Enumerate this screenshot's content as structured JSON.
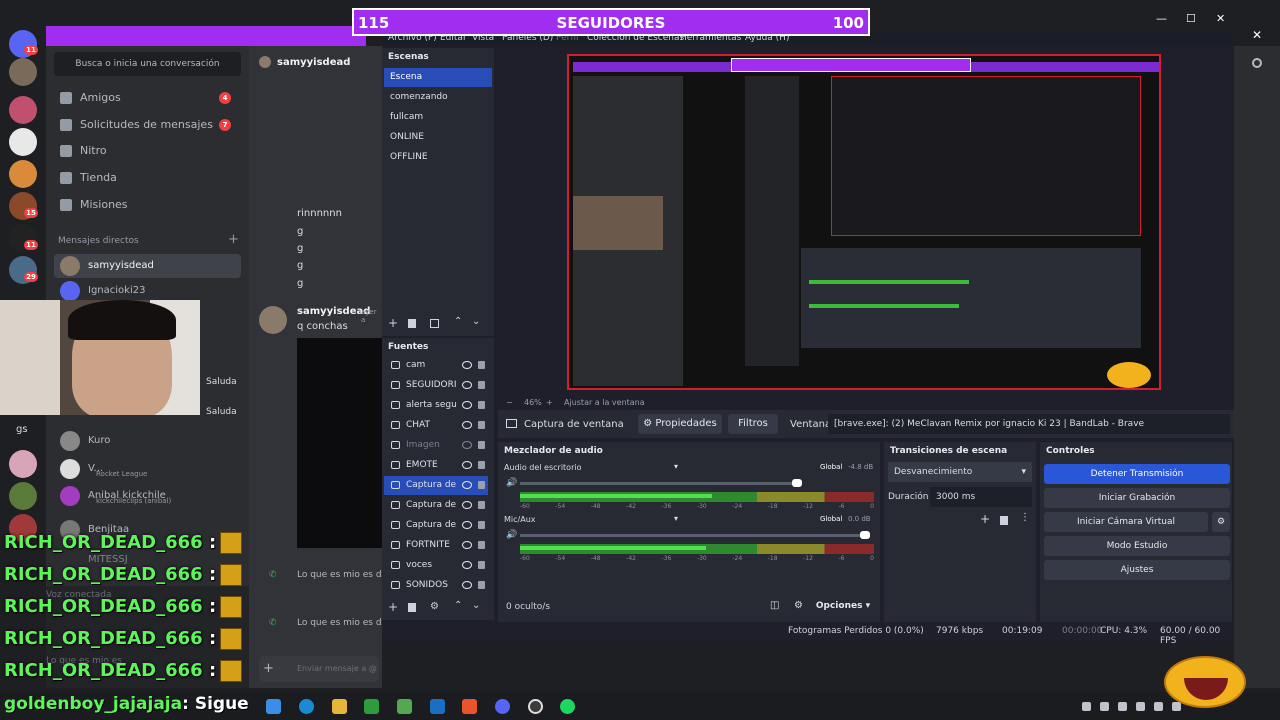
{
  "follower_bar": {
    "left_count": "115",
    "title": "SEGUIDORES",
    "right_count": "100"
  },
  "discord": {
    "search_placeholder": "Busca o inicia una conversación",
    "nav": [
      {
        "label": "Amigos",
        "badge": "4"
      },
      {
        "label": "Solicitudes de mensajes",
        "badge": "7"
      },
      {
        "label": "Nitro",
        "badge": ""
      },
      {
        "label": "Tienda",
        "badge": ""
      },
      {
        "label": "Misiones",
        "badge": ""
      }
    ],
    "dm_header": "Mensajes directos",
    "dms": [
      {
        "name": "samyyisdead",
        "sub": ""
      },
      {
        "name": "Ignacioki23",
        "sub": ""
      },
      {
        "name": "Kuro",
        "sub": ""
      },
      {
        "name": "V...",
        "sub": "Rocket League"
      },
      {
        "name": "Anibal kickchile",
        "sub": "kickchileclips (anibal)"
      },
      {
        "name": "Benjitaa",
        "sub": ""
      },
      {
        "name": "MITESSJ",
        "sub": ""
      }
    ],
    "guild_badges": [
      "11",
      "15",
      "11",
      "29"
    ],
    "guild_label": "gs",
    "voice_status": "Voz conectada",
    "greet_labels": [
      "Saluda",
      "Saluda"
    ],
    "chat": {
      "header": "samyyisdead",
      "lines": [
        "rinnnnnn",
        "g",
        "g",
        "g",
        "g"
      ],
      "msg_author": "samyyisdead",
      "msg_time": "ayer a",
      "msg_text": "q conchas",
      "call_text_1": "Lo que es mio es d",
      "call_text_2": "Lo que es mio es d",
      "input_placeholder": "Enviar mensaje a @samyyisdead",
      "faint_label": "Lo que es mio es"
    },
    "rocket_label": "Rocket League"
  },
  "obs": {
    "menu": [
      "Archivo (F)",
      "Editar",
      "Vista",
      "Paneles (D)",
      "Perfil",
      "Colección de Escenas",
      "Herramientas",
      "Ayuda (H)"
    ],
    "scenes_title": "Escenas",
    "scenes": [
      "Escena",
      "comenzando",
      "fullcam",
      "ONLINE",
      "OFFLINE"
    ],
    "sources_title": "Fuentes",
    "sources": [
      "cam",
      "SEGUIDORI",
      "alerta segu",
      "CHAT",
      "Imagen",
      "EMOTE",
      "Captura de",
      "Captura de",
      "Captura de",
      "FORTNITE",
      "voces",
      "SONIDOS"
    ],
    "zoom": "46%",
    "fit_label": "Ajustar a la ventana",
    "capture_label": "Captura de ventana",
    "properties": "Propiedades",
    "filters": "Filtros",
    "window_label": "Ventana",
    "window_value": "[brave.exe]: (2) MeClavan Remix por ignacio Ki 23 | BandLab - Brave",
    "mixer_title": "Mezclador de audio",
    "mixer": [
      {
        "name": "Audio del escritorio",
        "tag": "Global",
        "db": "-4.8 dB",
        "level": 0.62
      },
      {
        "name": "Mic/Aux",
        "tag": "Global",
        "db": "0.0 dB",
        "level": 0.55
      }
    ],
    "scale": [
      "-60",
      "-54",
      "-48",
      "-42",
      "-36",
      "-30",
      "-24",
      "-18",
      "-12",
      "-6",
      "0"
    ],
    "hidden_count": "0 oculto/s",
    "options": "Opciones",
    "transitions_title": "Transiciones de escena",
    "transition": "Desvanecimiento",
    "duration_label": "Duración",
    "duration": "3000 ms",
    "controls_title": "Controles",
    "controls": [
      "Detener Transmisión",
      "Iniciar Grabación",
      "Iniciar Cámara Virtual",
      "Modo Estudio",
      "Ajustes"
    ],
    "status": {
      "dropped": "Fotogramas Perdidos 0 (0.0%)",
      "kbps": "7976 kbps",
      "live_time": "00:19:09",
      "rec_time": "00:00:00",
      "cpu": "CPU: 4.3%",
      "fps": "60.00 / 60.00 FPS"
    }
  },
  "stream_chat": {
    "lines": [
      {
        "user": "RICH_OR_DEAD_666",
        "msg": ":"
      },
      {
        "user": "RICH_OR_DEAD_666",
        "msg": ":"
      },
      {
        "user": "RICH_OR_DEAD_666",
        "msg": ":"
      },
      {
        "user": "RICH_OR_DEAD_666",
        "msg": ":"
      },
      {
        "user": "RICH_OR_DEAD_666",
        "msg": ":"
      }
    ],
    "follow_user": "goldenboy_jajajaja",
    "follow_msg": ": Sigue"
  },
  "colors": {
    "accent": "#a12df0",
    "obs_blue": "#2a56d8",
    "chat_green": "#5ff55a",
    "red": "#d21e2e"
  }
}
